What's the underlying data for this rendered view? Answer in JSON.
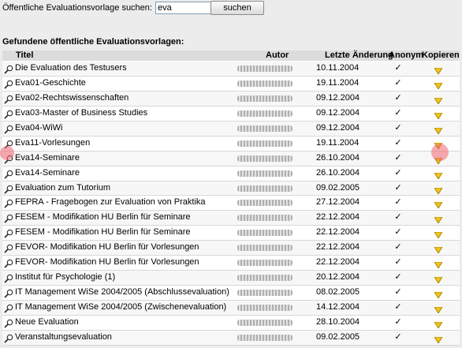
{
  "search": {
    "label": "Öffentliche Evaluationsvorlage suchen:",
    "value": "eva",
    "button": "suchen"
  },
  "section_title": "Gefundene öffentliche Evaluationsvorlagen:",
  "columns": {
    "title": "Titel",
    "author": "Autor",
    "changed": "Letzte Änderung",
    "anonym": "Anonym",
    "copy": "Kopieren"
  },
  "check_symbol": "✓",
  "icons": {
    "view": "magnifier-icon",
    "copy": "copy-arrow-icon"
  },
  "colors": {
    "copy_icon": "#f0c419",
    "highlight": "#f06470"
  },
  "rows": [
    {
      "title": "Die Evaluation des Testusers",
      "date": "10.11.2004"
    },
    {
      "title": "Eva01-Geschichte",
      "date": "19.11.2004"
    },
    {
      "title": "Eva02-Rechtswissenschaften",
      "date": "09.12.2004"
    },
    {
      "title": "Eva03-Master of Business Studies",
      "date": "09.12.2004"
    },
    {
      "title": "Eva04-WiWi",
      "date": "09.12.2004"
    },
    {
      "title": "Eva11-Vorlesungen",
      "date": "19.11.2004"
    },
    {
      "title": "Eva14-Seminare",
      "date": "26.10.2004"
    },
    {
      "title": "Eva14-Seminare",
      "date": "26.10.2004"
    },
    {
      "title": "Evaluation zum Tutorium",
      "date": "09.02.2005"
    },
    {
      "title": "FEPRA - Fragebogen zur Evaluation von Praktika",
      "date": "27.12.2004"
    },
    {
      "title": "FESEM - Modifikation HU Berlin für Seminare",
      "date": "22.12.2004"
    },
    {
      "title": "FESEM - Modifikation HU Berlin für Seminare",
      "date": "22.12.2004"
    },
    {
      "title": "FEVOR- Modifikation HU Berlin für Vorlesungen",
      "date": "22.12.2004"
    },
    {
      "title": "FEVOR- Modifikation HU Berlin für Vorlesungen",
      "date": "22.12.2004"
    },
    {
      "title": "Institut für Psychologie (1)",
      "date": "20.12.2004"
    },
    {
      "title": "IT Management WiSe 2004/2005 (Abschlussevaluation)",
      "date": "08.02.2005"
    },
    {
      "title": "IT Management WiSe 2004/2005 (Zwischenevaluation)",
      "date": "14.12.2004"
    },
    {
      "title": "Neue Evaluation",
      "date": "28.10.2004"
    },
    {
      "title": "Veranstaltungsevaluation",
      "date": "09.02.2005"
    }
  ]
}
